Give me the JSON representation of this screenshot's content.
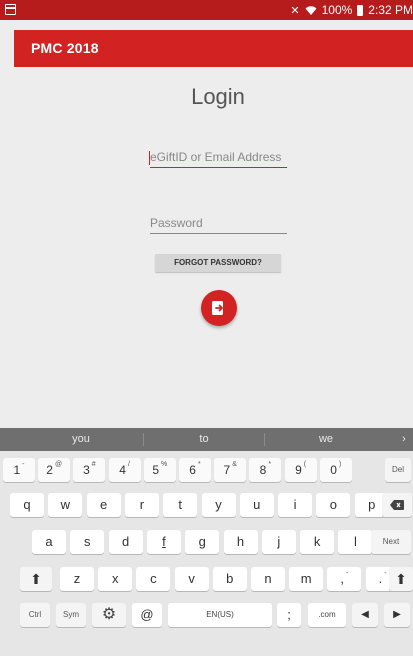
{
  "status_bar": {
    "wifi": "100%",
    "time": "2:32 PM",
    "icons": [
      "calendar-icon",
      "signal-icon",
      "wifi-icon",
      "battery-icon"
    ]
  },
  "app_bar": {
    "title": "PMC 2018",
    "color": "#d32222"
  },
  "login": {
    "title": "Login",
    "email_placeholder": "eGiftID or Email Address",
    "password_placeholder": "Password",
    "forgot_label": "FORGOT PASSWORD?",
    "submit_icon": "login-icon"
  },
  "keyboard": {
    "suggestions": [
      "you",
      "to",
      "we"
    ],
    "suggestions_more": "›",
    "number_row": [
      {
        "k": "1",
        "s": "-"
      },
      {
        "k": "2",
        "s": "@"
      },
      {
        "k": "3",
        "s": "#"
      },
      {
        "k": "4",
        "s": "/"
      },
      {
        "k": "5",
        "s": "%"
      },
      {
        "k": "6",
        "s": "*"
      },
      {
        "k": "7",
        "s": "&"
      },
      {
        "k": "8",
        "s": "*"
      },
      {
        "k": "9",
        "s": "("
      },
      {
        "k": "0",
        "s": ")"
      }
    ],
    "del_label": "Del",
    "row1": [
      "q",
      "w",
      "e",
      "r",
      "t",
      "y",
      "u",
      "i",
      "o",
      "p"
    ],
    "row2": [
      "a",
      "s",
      "d",
      "f",
      "g",
      "h",
      "j",
      "k",
      "l"
    ],
    "next_label": "Next",
    "row3": [
      "z",
      "x",
      "c",
      "v",
      "b",
      "n",
      "m",
      ",",
      "."
    ],
    "row3_sup": [
      "",
      "",
      "",
      "",
      "",
      "",
      "",
      "-",
      "-"
    ],
    "ctrl_label": "Ctrl",
    "sym_label": "Sym",
    "at_label": "@",
    "space_label": "EN(US)",
    "semicolon_label": ";",
    "com_label": ".com",
    "com_sup": "…"
  }
}
